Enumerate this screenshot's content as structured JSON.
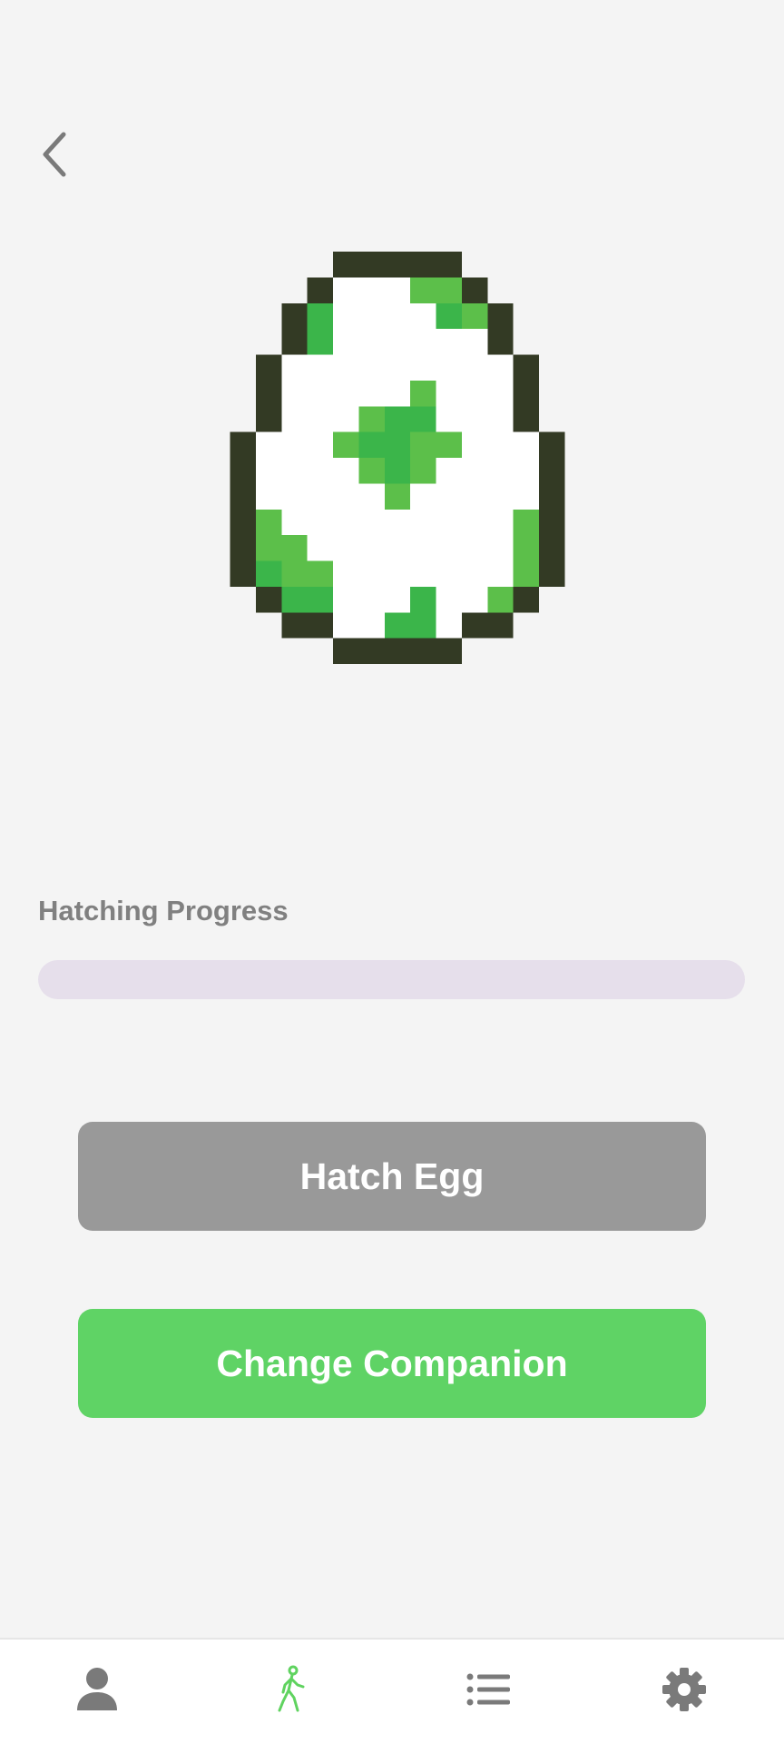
{
  "header": {
    "back_icon": "chevron-left-icon"
  },
  "egg": {
    "icon": "pixel-egg-icon",
    "colors": {
      "outline": "#333a24",
      "shell": "#ffffff",
      "spot_light": "#5cbf4a",
      "spot_dark": "#3bb54a"
    }
  },
  "progress": {
    "label": "Hatching Progress",
    "value": 0,
    "track_color": "#e6dfeb",
    "fill_color": "#5fd35f"
  },
  "actions": {
    "hatch_label": "Hatch Egg",
    "hatch_color": "#999999",
    "change_label": "Change Companion",
    "change_color": "#5fd365"
  },
  "tabbar": {
    "tabs": [
      {
        "icon": "person-icon",
        "active": false
      },
      {
        "icon": "walking-figure-icon",
        "active": true
      },
      {
        "icon": "list-icon",
        "active": false
      },
      {
        "icon": "gear-icon",
        "active": false
      }
    ],
    "active_color": "#5fd35f",
    "inactive_color": "#7a7a7a"
  }
}
